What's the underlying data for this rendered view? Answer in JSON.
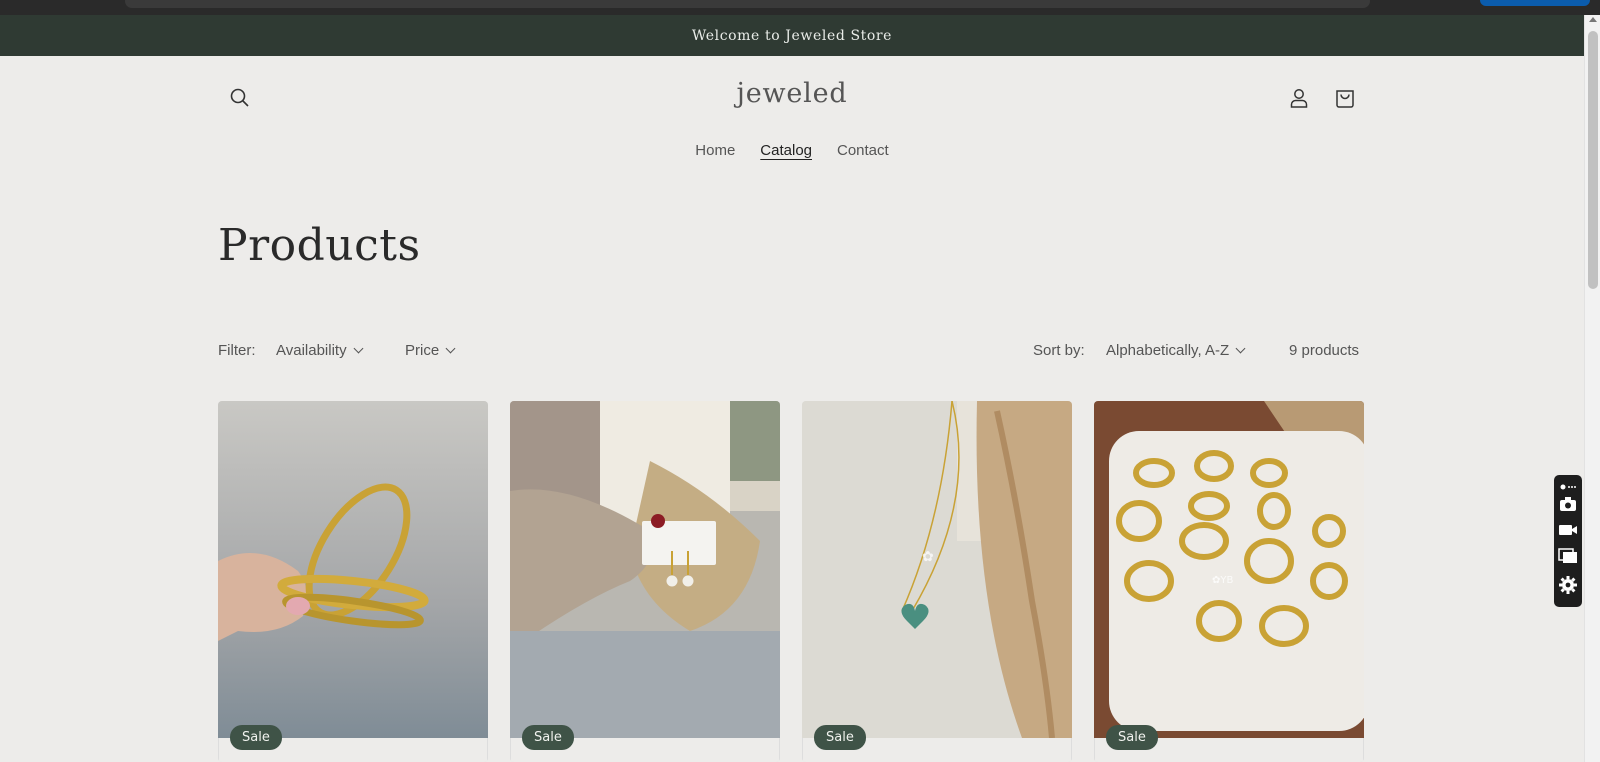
{
  "announcement": {
    "text": "Welcome to Jeweled Store"
  },
  "header": {
    "logo": "jeweled",
    "nav": [
      {
        "label": "Home",
        "active": false
      },
      {
        "label": "Catalog",
        "active": true
      },
      {
        "label": "Contact",
        "active": false
      }
    ],
    "icons": [
      "search-icon",
      "account-icon",
      "cart-icon"
    ]
  },
  "page": {
    "title": "Products"
  },
  "filters": {
    "filter_label": "Filter:",
    "availability_label": "Availability",
    "price_label": "Price",
    "sort_label": "Sort by:",
    "sort_value": "Alphabetically, A-Z",
    "count": "9 products"
  },
  "products": [
    {
      "badge": "Sale",
      "image": "gold-bangles"
    },
    {
      "badge": "Sale",
      "image": "pearl-earrings"
    },
    {
      "badge": "Sale",
      "image": "heart-pendant-necklace"
    },
    {
      "badge": "Sale",
      "image": "gold-rings-tray"
    }
  ],
  "colors": {
    "announcement_bg": "#2f3a33",
    "page_bg": "#edecea",
    "badge_bg": "#3f5347"
  }
}
